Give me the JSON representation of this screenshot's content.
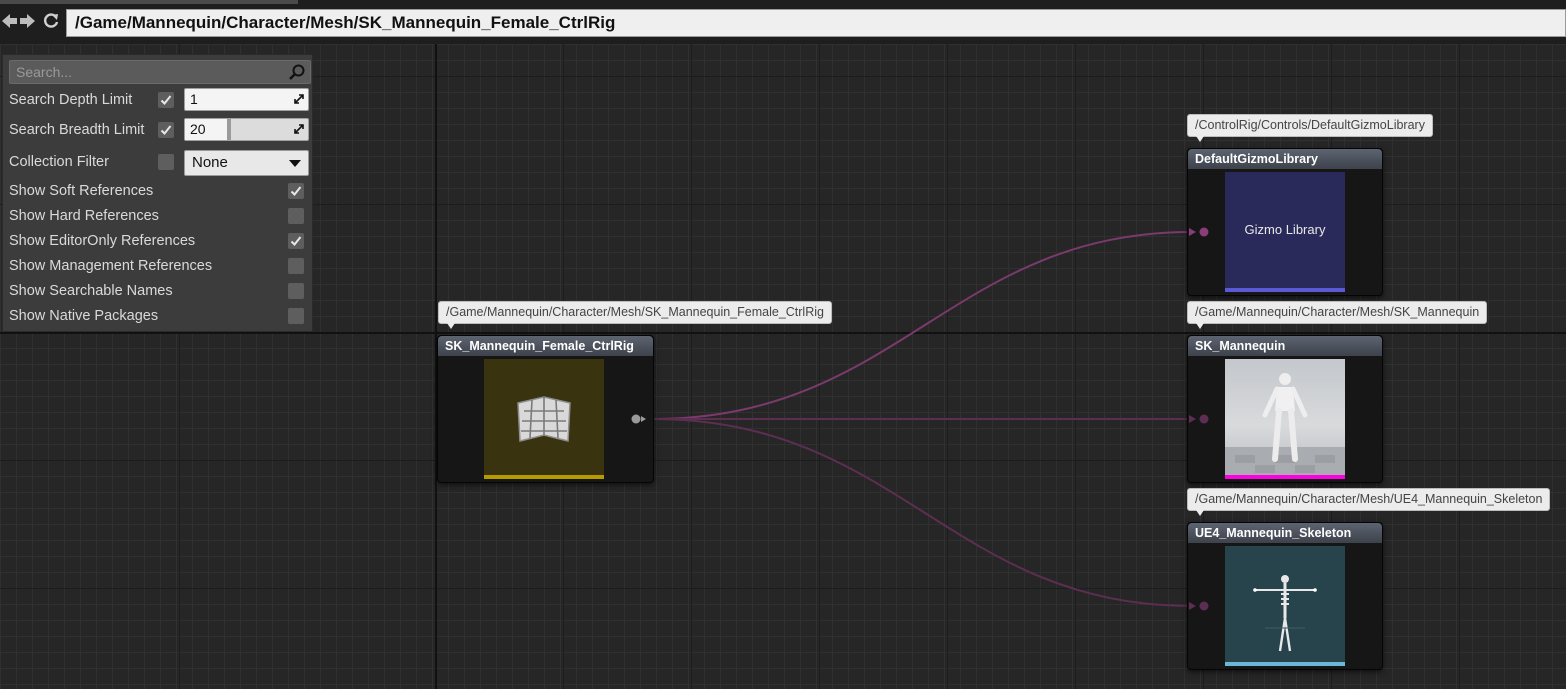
{
  "toolbar": {
    "path": "/Game/Mannequin/Character/Mesh/SK_Mannequin_Female_CtrlRig"
  },
  "settings": {
    "search_placeholder": "Search...",
    "depth_label": "Search Depth Limit",
    "depth_checked": true,
    "depth_value": "1",
    "breadth_label": "Search Breadth Limit",
    "breadth_checked": true,
    "breadth_value": "20",
    "collection_label": "Collection Filter",
    "collection_checked": false,
    "collection_value": "None",
    "options": [
      {
        "label": "Show Soft References",
        "checked": true
      },
      {
        "label": "Show Hard References",
        "checked": false
      },
      {
        "label": "Show EditorOnly References",
        "checked": true
      },
      {
        "label": "Show Management References",
        "checked": false
      },
      {
        "label": "Show Searchable Names",
        "checked": false
      },
      {
        "label": "Show Native Packages",
        "checked": false
      }
    ]
  },
  "nodes": {
    "root": {
      "path": "/Game/Mannequin/Character/Mesh/SK_Mannequin_Female_CtrlRig",
      "title": "SK_Mannequin_Female_CtrlRig",
      "icon": "control-rig-map-icon",
      "color": "#b59a00"
    },
    "gizmo": {
      "path": "/ControlRig/Controls/DefaultGizmoLibrary",
      "title": "DefaultGizmoLibrary",
      "thumb_text": "Gizmo Library",
      "color": "#5a5ad6"
    },
    "mesh": {
      "path": "/Game/Mannequin/Character/Mesh/SK_Mannequin",
      "title": "SK_Mannequin",
      "icon": "mannequin-thumbnail",
      "color": "#ff00e0"
    },
    "skeleton": {
      "path": "/Game/Mannequin/Character/Mesh/UE4_Mannequin_Skeleton",
      "title": "UE4_Mannequin_Skeleton",
      "icon": "skeleton-thumbnail",
      "color": "#6ab7d8"
    }
  },
  "wire_color": "#8a3d78"
}
